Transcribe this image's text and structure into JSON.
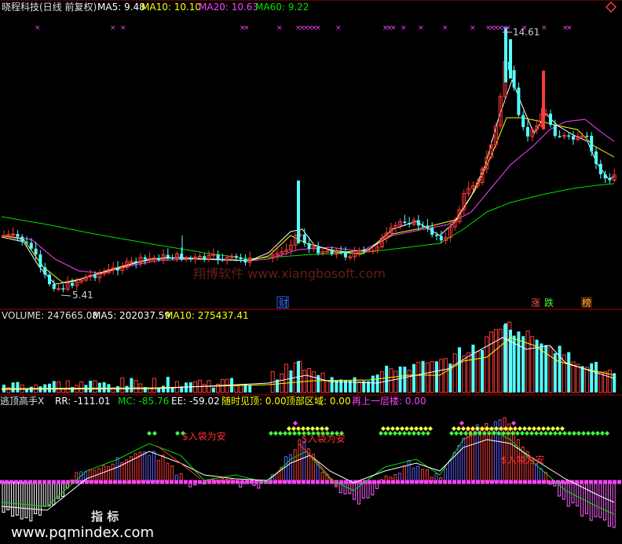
{
  "header": {
    "title": "晓程科技(日线 前复权)",
    "ma5_label": "MA5: 9.48",
    "ma10_label": "MA10: 10.10",
    "ma20_label": "MA20: 10.63",
    "ma60_label": "MA60: 9.22"
  },
  "price_panel": {
    "high_label": "14.61",
    "low_label": "5.41",
    "watermark": "翔博软件 www.xiangbosoft.com",
    "badges": {
      "cai": "财",
      "zhang": "涨",
      "die": "跌",
      "bang": "榜"
    }
  },
  "volume_panel": {
    "volume_label": "VOLUME: 247665.08",
    "ma5_label": "MA5: 202037.59",
    "ma10_label": "MA10: 275437.41"
  },
  "indicator_panel": {
    "name": "逃顶高手X",
    "rr_label": "RR: -111.01",
    "mc_label": "MC: -85.76",
    "ee_label": "EE: -59.02",
    "sui_label": "随时见顶: 0.00",
    "dingbu_label": "顶部区域: 0.00",
    "zai_label": "再上一层楼: 0.00",
    "signal_text": "$入袋为安",
    "footer_text": "指 标",
    "site_text": "www.pqmindex.com"
  },
  "colors": {
    "up": "#ff3b3b",
    "down": "#54ffff",
    "ma5": "#ffffff",
    "ma10": "#ffff00",
    "ma20": "#ff40ff",
    "ma60": "#00e000",
    "divider": "#b00000"
  },
  "chart_data": {
    "type": "candlestick",
    "price_range": [
      5.41,
      14.61
    ],
    "series": [
      {
        "name": "MA5",
        "values": [
          9.48
        ]
      },
      {
        "name": "MA10",
        "values": [
          10.1
        ]
      },
      {
        "name": "MA20",
        "values": [
          10.63
        ]
      },
      {
        "name": "MA60",
        "values": [
          9.22
        ]
      }
    ],
    "volume": {
      "latest": 247665.08,
      "ma5": 202037.59,
      "ma10": 275437.41
    },
    "indicator": {
      "RR": -111.01,
      "MC": -85.76,
      "EE": -59.02,
      "随时见顶": 0.0,
      "顶部区域": 0.0,
      "再上一层楼": 0.0
    }
  }
}
